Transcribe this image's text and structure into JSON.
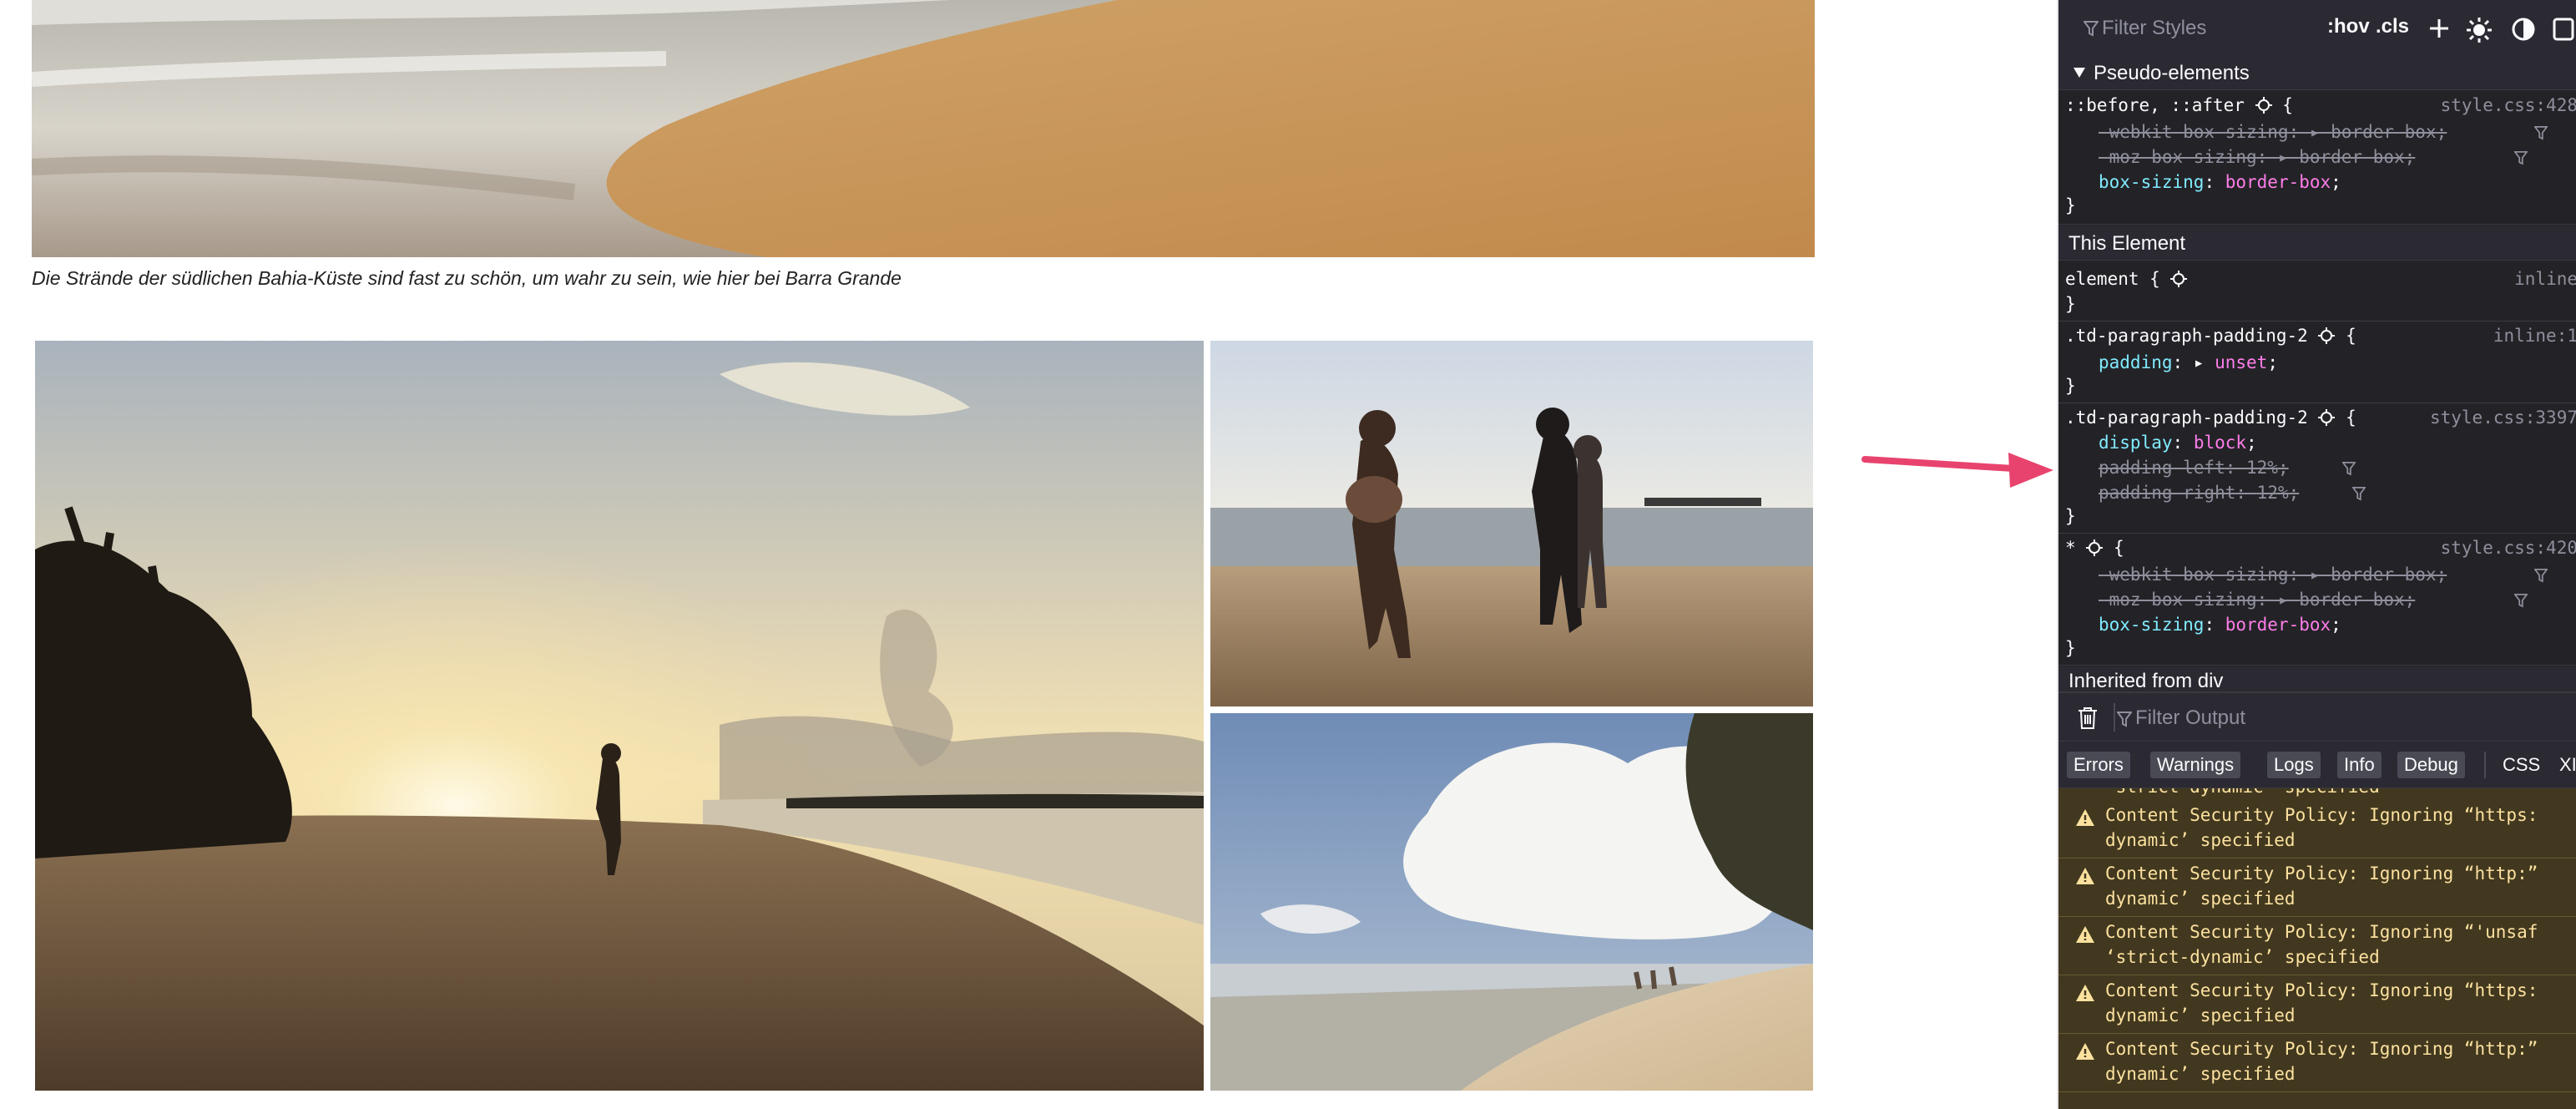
{
  "page": {
    "caption": "Die Strände der südlichen Bahia-Küste sind fast zu schön, um wahr zu sein, wie hier bei Barra Grande"
  },
  "devtools": {
    "rules": {
      "filter_placeholder": "Filter Styles",
      "hov_label": ":hov",
      "cls_label": ".cls",
      "pseudo_header": "Pseudo-elements",
      "pseudo_rule": {
        "selector": "::before, ::after",
        "source": "style.css:428",
        "decls": [
          {
            "name": "-webkit-box-sizing",
            "value": "border-box",
            "overridden": true
          },
          {
            "name": "-moz-box-sizing",
            "value": "border-box",
            "overridden": true
          },
          {
            "name": "box-sizing",
            "value": "border-box",
            "overridden": false
          }
        ]
      },
      "this_element_header": "This Element",
      "element_rule": {
        "selector": "element",
        "source": "inline"
      },
      "rule2": {
        "selector": ".td-paragraph-padding-2",
        "source": "inline:1",
        "decls": [
          {
            "name": "padding",
            "value": "unset"
          }
        ]
      },
      "rule3": {
        "selector": ".td-paragraph-padding-2",
        "source": "style.css:3397",
        "decls": [
          {
            "name": "display",
            "value": "block",
            "overridden": false
          },
          {
            "name": "padding-left",
            "value": "12%",
            "overridden": true
          },
          {
            "name": "padding-right",
            "value": "12%",
            "overridden": true
          }
        ]
      },
      "rule4": {
        "selector": "*",
        "source": "style.css:420",
        "decls": [
          {
            "name": "-webkit-box-sizing",
            "value": "border-box",
            "overridden": true
          },
          {
            "name": "-moz-box-sizing",
            "value": "border-box",
            "overridden": true
          },
          {
            "name": "box-sizing",
            "value": "border-box",
            "overridden": false
          }
        ]
      },
      "inherited_header": "Inherited from div",
      "brace_open": "{",
      "brace_close": "}",
      "colon": ":",
      "semicolon": ";"
    },
    "console": {
      "filter_placeholder": "Filter Output",
      "tabs": [
        "Errors",
        "Warnings",
        "Logs",
        "Info",
        "Debug"
      ],
      "css_label": "CSS",
      "xhr_label": "XI",
      "top_fragment": "'strict-dynamic' specified",
      "messages": [
        {
          "line1": "Content Security Policy: Ignoring “https:",
          "line2": "dynamic’ specified"
        },
        {
          "line1": "Content Security Policy: Ignoring “http:”",
          "line2": "dynamic’ specified"
        },
        {
          "line1": "Content Security Policy: Ignoring “'unsaf",
          "line2": "‘strict-dynamic’ specified"
        },
        {
          "line1": "Content Security Policy: Ignoring “https:",
          "line2": "dynamic’ specified"
        },
        {
          "line1": "Content Security Policy: Ignoring “http:”",
          "line2": "dynamic’ specified"
        }
      ]
    }
  },
  "colors": {
    "warning_text": "#fce19f",
    "warning_bg": "#42381f",
    "prop_name": "#80ebff",
    "prop_value": "#ff7de9",
    "arrow": "#e8436e"
  }
}
